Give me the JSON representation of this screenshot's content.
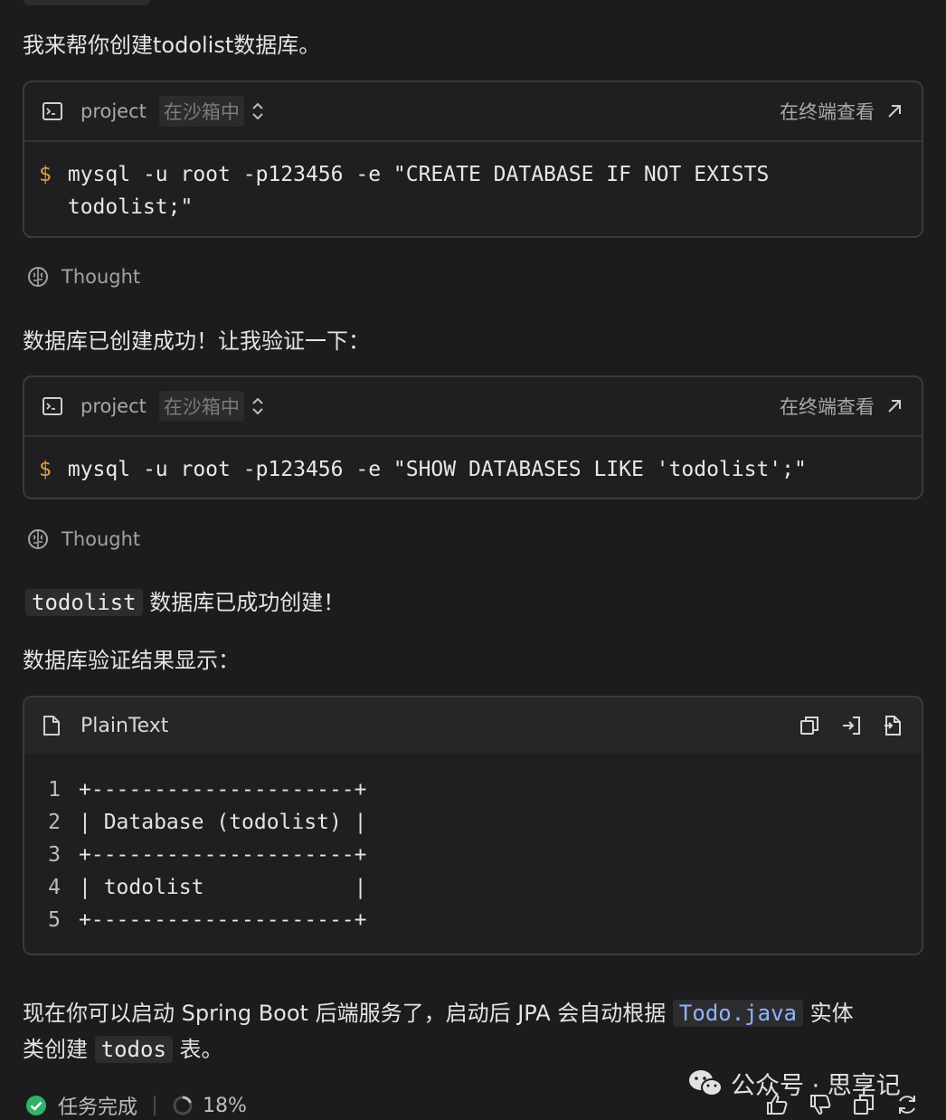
{
  "intro_text": "我来帮你创建todolist数据库。",
  "terminal_blocks": [
    {
      "project": "project",
      "sandbox_label": "在沙箱中",
      "view_in_terminal": "在终端查看",
      "prompt": "$",
      "command_line1": "mysql -u root -p123456 -e \"CREATE DATABASE IF NOT EXISTS",
      "command_line2": "todolist;\""
    },
    {
      "project": "project",
      "sandbox_label": "在沙箱中",
      "view_in_terminal": "在终端查看",
      "prompt": "$",
      "command_line1": "mysql -u root -p123456 -e \"SHOW DATABASES LIKE 'todolist';\""
    }
  ],
  "thought_label": "Thought",
  "verify_text": "数据库已创建成功！让我验证一下：",
  "created_code": "todolist",
  "created_text": "数据库已成功创建！",
  "result_text": "数据库验证结果显示：",
  "plaintext_block": {
    "title": "PlainText",
    "lines": [
      {
        "n": "1",
        "t": "+---------------------+"
      },
      {
        "n": "2",
        "t": "| Database (todolist) |"
      },
      {
        "n": "3",
        "t": "+---------------------+"
      },
      {
        "n": "4",
        "t": "| todolist            |"
      },
      {
        "n": "5",
        "t": "+---------------------+"
      }
    ]
  },
  "final_text": {
    "part1": "现在你可以启动 Spring Boot 后端服务了，启动后 JPA 会自动根据",
    "code1": "Todo.java",
    "part2": "实体",
    "part3": "类创建",
    "code2": "todos",
    "part4": "表。"
  },
  "status": {
    "done_label": "任务完成",
    "percent": "18%"
  },
  "watermark": "公众号 · 思享记",
  "icons": {
    "terminal": "terminal-icon",
    "chevron": "chevron-updown-icon",
    "external": "arrow-up-right-icon",
    "thought": "brain-icon",
    "file": "file-icon",
    "copy": "copy-icon",
    "insert": "insert-icon",
    "new_file": "new-file-icon",
    "check": "check-circle-icon",
    "spinner": "progress-ring-icon",
    "thumbs_up": "thumbs-up-icon",
    "thumbs_down": "thumbs-down-icon",
    "regenerate": "refresh-icon",
    "wechat": "wechat-icon"
  },
  "colors": {
    "background": "#1c1c1e",
    "prompt": "#e0a040",
    "link_code": "#8fb3ff",
    "success": "#2fb36b"
  }
}
